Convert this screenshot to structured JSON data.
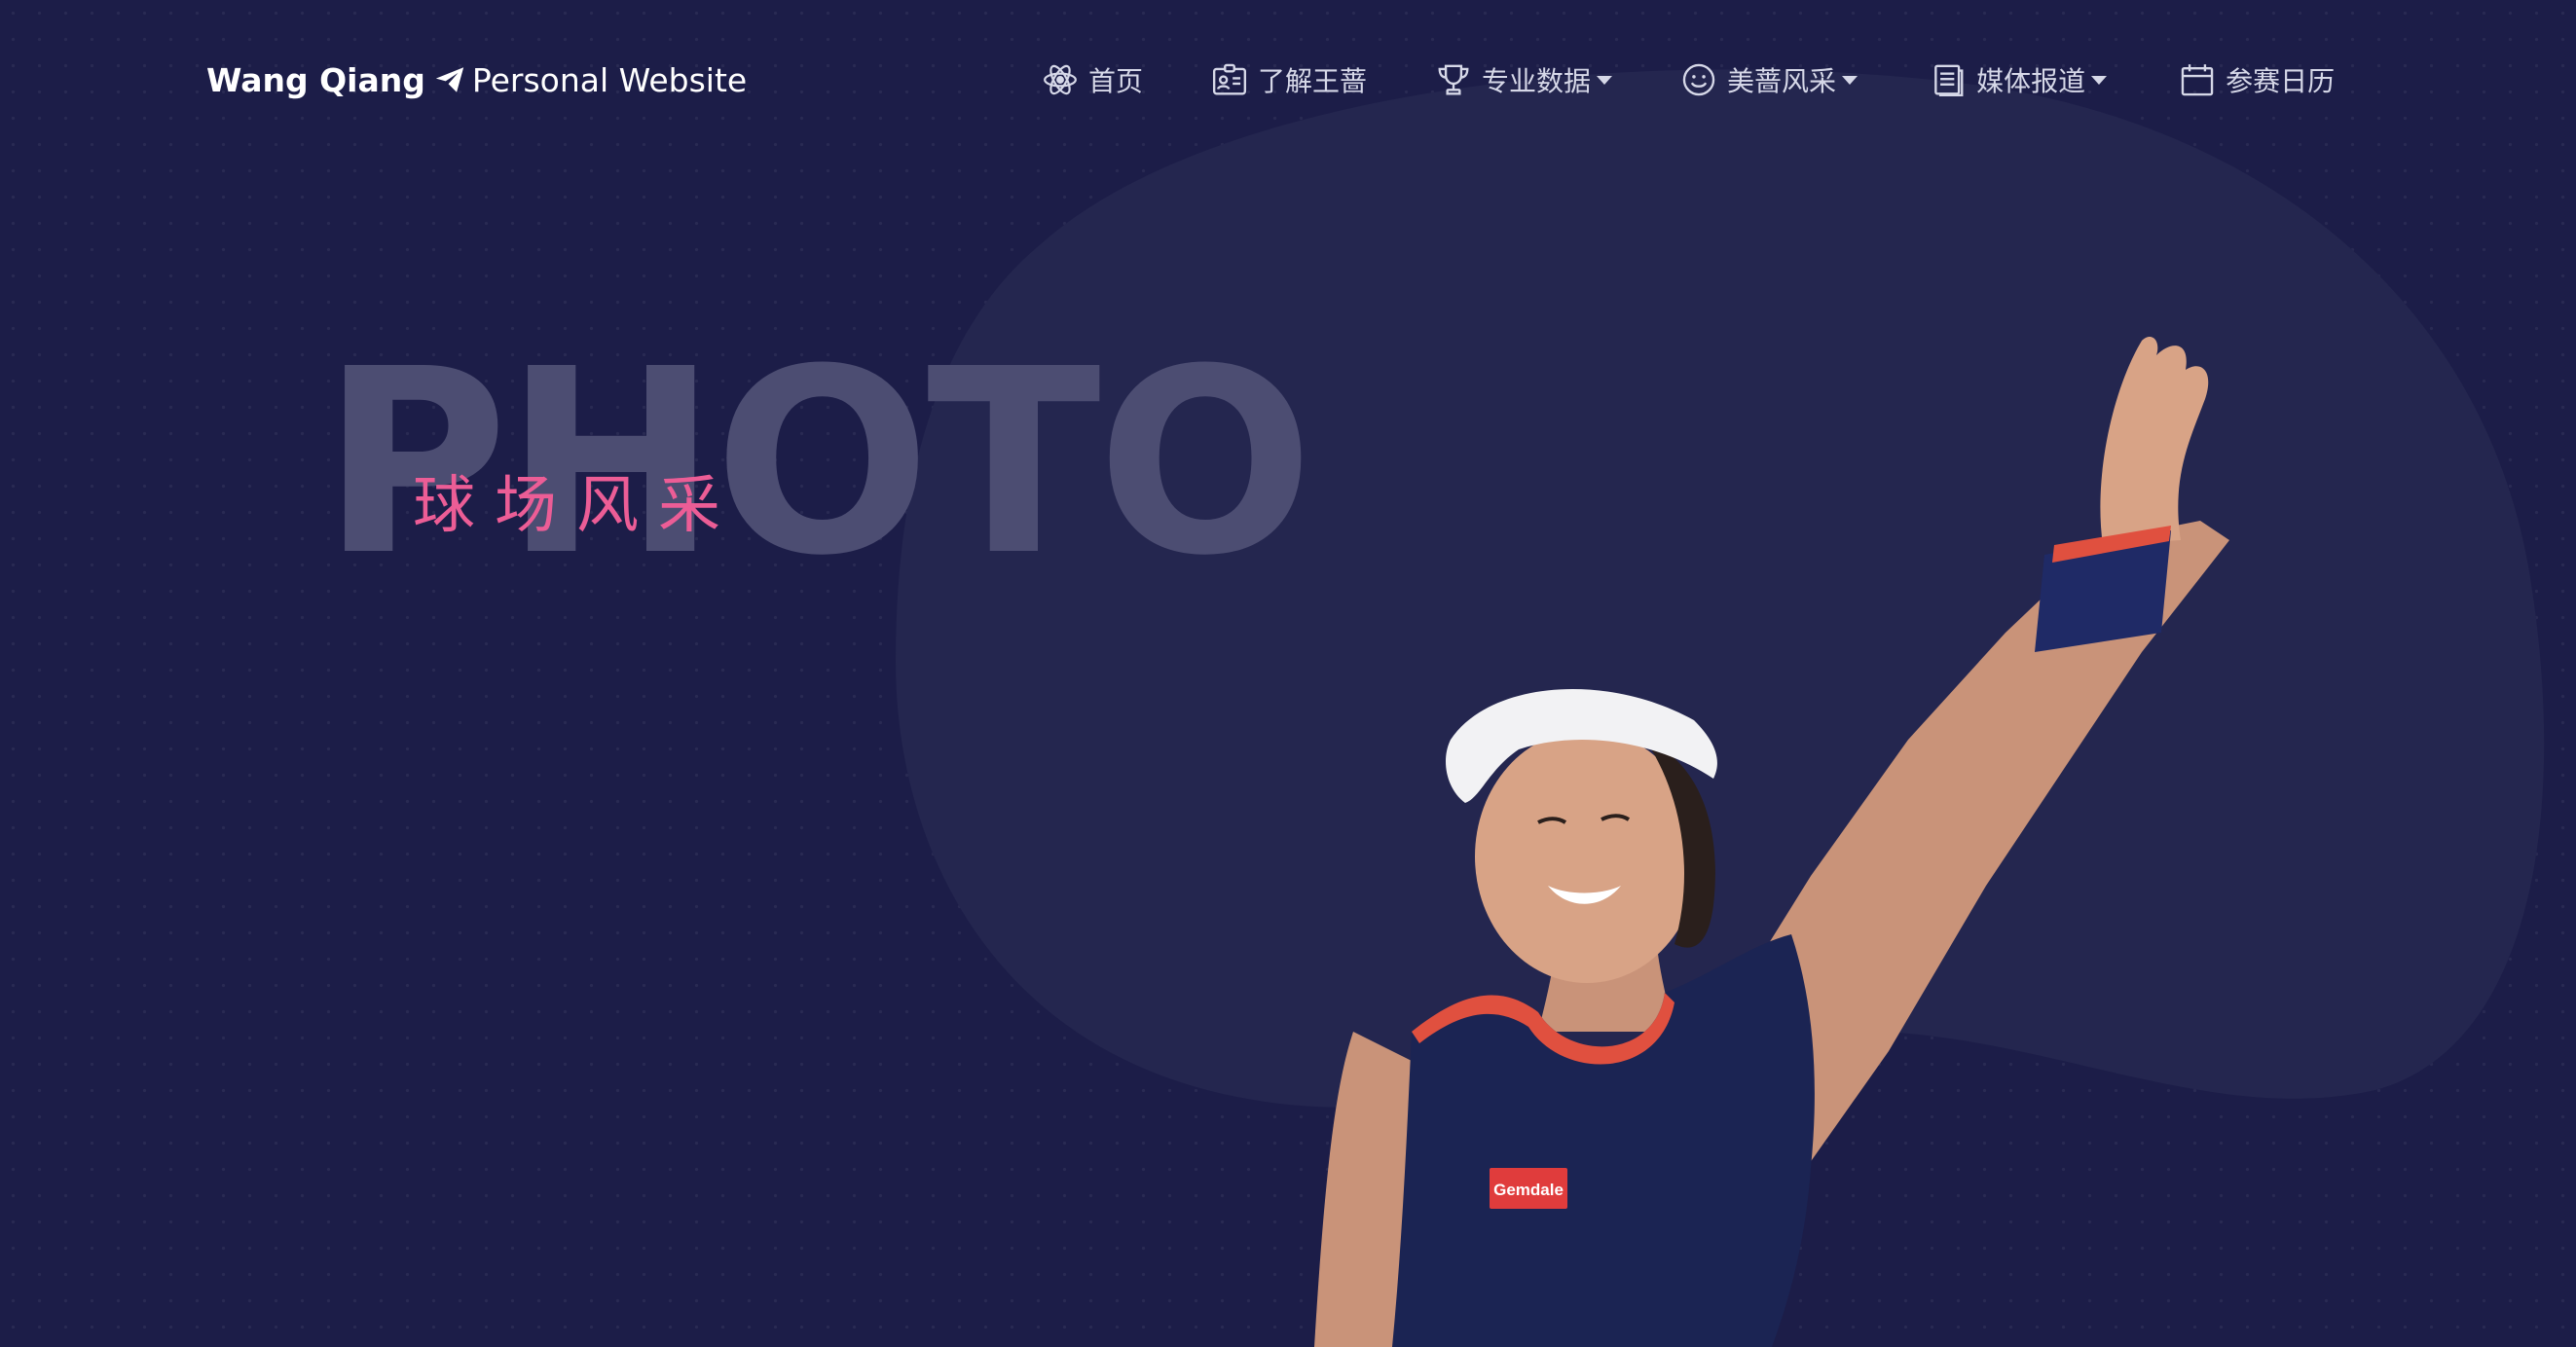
{
  "brand": {
    "name": "Wang Qiang",
    "tagline": "Personal Website",
    "icon": "paper-plane-icon"
  },
  "nav": {
    "items": [
      {
        "label": "首页",
        "icon": "atom-icon",
        "dropdown": false
      },
      {
        "label": "了解王蔷",
        "icon": "id-card-icon",
        "dropdown": false
      },
      {
        "label": "专业数据",
        "icon": "trophy-icon",
        "dropdown": true
      },
      {
        "label": "美蔷风采",
        "icon": "smile-icon",
        "dropdown": true
      },
      {
        "label": "媒体报道",
        "icon": "document-icon",
        "dropdown": true
      },
      {
        "label": "参赛日历",
        "icon": "calendar-icon",
        "dropdown": false
      }
    ]
  },
  "hero": {
    "bg_word": "PHOTO",
    "subtitle": "球场风采",
    "photo_text": "Gemdale"
  },
  "colors": {
    "background": "#1c1d48",
    "blob": "#24264f",
    "accent_pink": "#ec5d96",
    "nav_text": "#d6d8e8"
  }
}
